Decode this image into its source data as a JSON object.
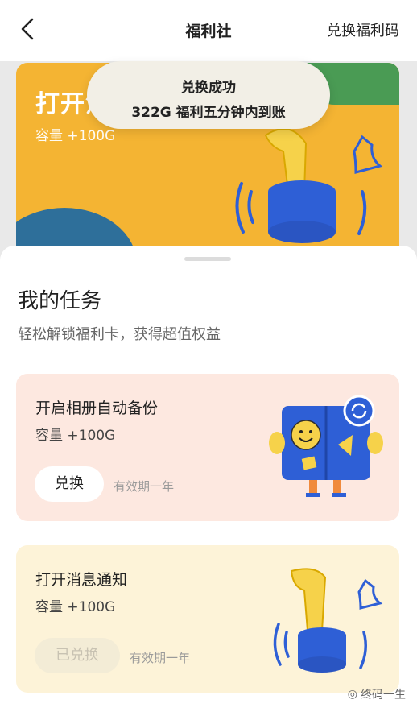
{
  "header": {
    "title": "福利社",
    "redeem_link": "兑换福利码",
    "back_icon": "chevron-left-icon"
  },
  "banner": {
    "title": "打开消息通知",
    "capacity": "容量 +100G"
  },
  "toast": {
    "line1": "兑换成功",
    "line2": "322G 福利五分钟内到账"
  },
  "tasks": {
    "title": "我的任务",
    "subtitle": "轻松解锁福利卡，获得超值权益",
    "items": [
      {
        "title": "开启相册自动备份",
        "capacity": "容量 +100G",
        "button": "兑换",
        "button_state": "enabled",
        "validity": "有效期一年",
        "icon": "photo-album-backup-icon"
      },
      {
        "title": "打开消息通知",
        "capacity": "容量 +100G",
        "button": "已兑换",
        "button_state": "disabled",
        "validity": "有效期一年",
        "icon": "notification-bell-icon"
      }
    ]
  },
  "watermark": "终码一生",
  "colors": {
    "banner": "#f4b433",
    "card_pink": "#fde8e0",
    "card_yellow": "#fdf3d8",
    "toast_bg": "#f2efe6"
  }
}
